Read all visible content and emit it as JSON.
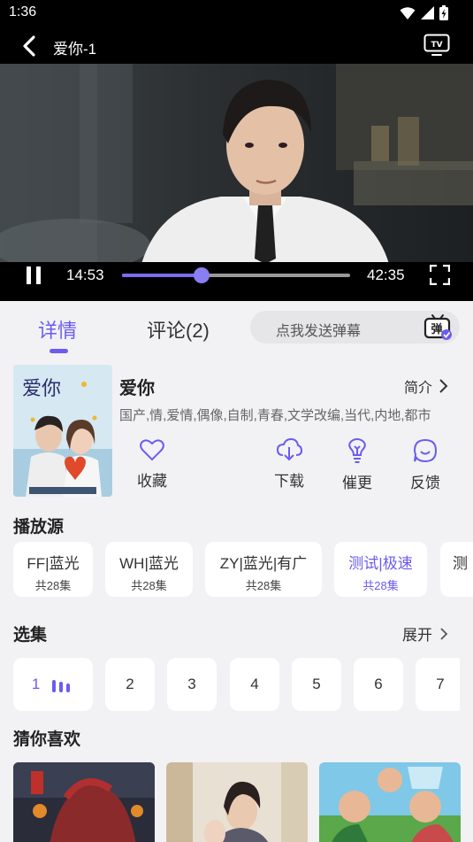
{
  "status_bar": {
    "time": "1:36"
  },
  "player": {
    "title": "爱你-1",
    "current_time": "14:53",
    "duration": "42:35",
    "progress": 0.35
  },
  "tabs": {
    "details": "详情",
    "comments": "评论(2)"
  },
  "danmu": {
    "placeholder": "点我发送弹幕",
    "icon_char": "弹"
  },
  "show": {
    "title": "爱你",
    "intro_label": "简介",
    "tags": "国产,情,爱情,偶像,自制,青春,文学改编,当代,内地,都市",
    "poster_title": "爱你",
    "actions": [
      {
        "label": "收藏",
        "icon": "heart-icon"
      },
      {
        "label": "下载",
        "icon": "download-icon"
      },
      {
        "label": "催更",
        "icon": "lightbulb-icon"
      },
      {
        "label": "反馈",
        "icon": "smile-icon"
      }
    ]
  },
  "sources_section": {
    "title": "播放源",
    "items": [
      {
        "name": "FF|蓝光",
        "count": "共28集"
      },
      {
        "name": "WH|蓝光",
        "count": "共28集"
      },
      {
        "name": "ZY|蓝光|有广",
        "count": "共28集"
      },
      {
        "name": "测试|极速",
        "count": "共28集"
      },
      {
        "name": "测",
        "count": ""
      }
    ],
    "active_index": 3
  },
  "episodes_section": {
    "title": "选集",
    "expand_label": "展开",
    "items": [
      "1",
      "2",
      "3",
      "4",
      "5",
      "6",
      "7"
    ],
    "active_index": 0
  },
  "recommend_section": {
    "title": "猜你喜欢"
  },
  "colors": {
    "accent": "#6b5cf0",
    "background": "#f2f2f4"
  }
}
